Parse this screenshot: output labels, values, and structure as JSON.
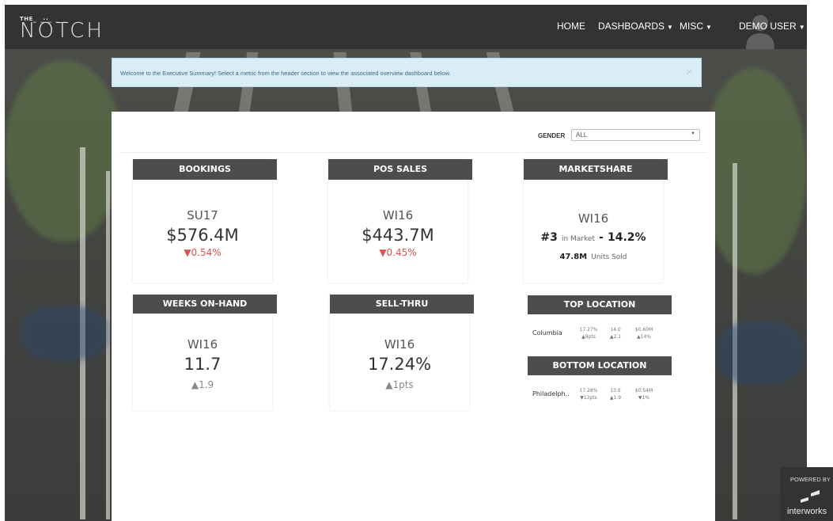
{
  "header": {
    "logo_small": "THE",
    "logo_dashes": "–––––",
    "logo_main": "NÖTCH",
    "nav": [
      {
        "label": "HOME",
        "dropdown": false
      },
      {
        "label": "DASHBOARDS",
        "dropdown": true
      },
      {
        "label": "MISC",
        "dropdown": true
      },
      {
        "label": "DEMO USER",
        "dropdown": true
      }
    ]
  },
  "alert": {
    "text": "Welcome to the Executive Summary! Select a metric from the header section to view the associated overview dashboard below.",
    "close": "×"
  },
  "filter": {
    "label": "GENDER",
    "value": "ALL"
  },
  "cards": {
    "bookings": {
      "title": "BOOKINGS",
      "season": "SU17",
      "value": "$576.4M",
      "change": "▼0.54%"
    },
    "pos_sales": {
      "title": "POS SALES",
      "season": "WI16",
      "value": "$443.7M",
      "change": "▼0.45%"
    },
    "marketshare": {
      "title": "MARKETSHARE",
      "season": "WI16",
      "rank": "#3",
      "rank_suffix": "in Market",
      "dash": "-",
      "share": "14.2%",
      "units": "47.8M",
      "units_suffix": "Units Sold"
    },
    "weeks_on_hand": {
      "title": "WEEKS ON-HAND",
      "season": "WI16",
      "value": "11.7",
      "change": "▲1.9"
    },
    "sell_thru": {
      "title": "SELL-THRU",
      "season": "WI16",
      "value": "17.24%",
      "change": "▲1pts"
    },
    "top_location": {
      "title": "TOP LOCATION",
      "name": "Columbia",
      "metrics": [
        {
          "value": "17.27%",
          "change": "▲8pts"
        },
        {
          "value": "14.0",
          "change": "▲2.1"
        },
        {
          "value": "$0.60M",
          "change": "▲14%"
        }
      ]
    },
    "bottom_location": {
      "title": "BOTTOM LOCATION",
      "name": "Philadelph..",
      "metrics": [
        {
          "value": "17.28%",
          "change": "▼13pts"
        },
        {
          "value": "13.6",
          "change": "▲1.9"
        },
        {
          "value": "$0.54M",
          "change": "▼1%"
        }
      ]
    }
  },
  "powered_by": {
    "label": "POWERED BY",
    "brand": "interworks"
  },
  "colors": {
    "header_bg": "#333333",
    "card_header_bg": "#4d4d4d",
    "negative": "#d9534f",
    "alert_bg": "#d8edf6"
  }
}
